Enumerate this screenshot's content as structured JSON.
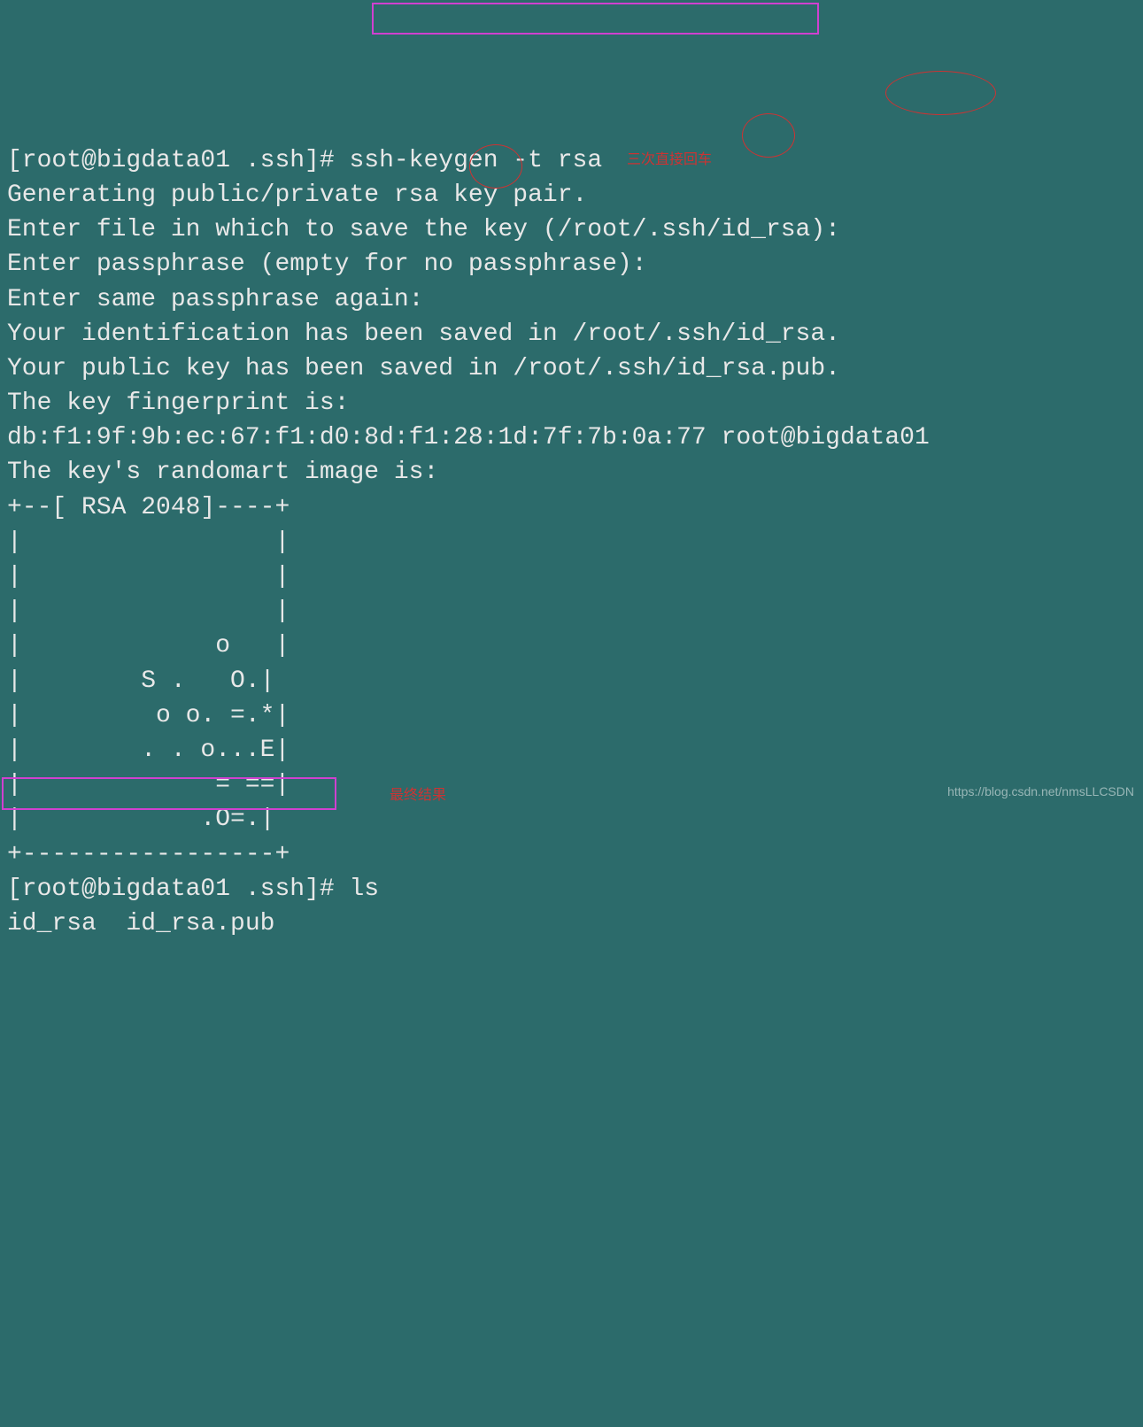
{
  "terminal": {
    "prompt1": "[root@bigdata01 .ssh]# ",
    "command1": "ssh-keygen -t rsa",
    "line1": "Generating public/private rsa key pair.",
    "line2": "Enter file in which to save the key (/root/.ssh/id_rsa):",
    "line3": "Enter passphrase (empty for no passphrase):",
    "line4": "Enter same passphrase again:",
    "line5": "Your identification has been saved in /root/.ssh/id_rsa.",
    "line6": "Your public key has been saved in /root/.ssh/id_rsa.pub.",
    "line7": "The key fingerprint is:",
    "line8": "db:f1:9f:9b:ec:67:f1:d0:8d:f1:28:1d:7f:7b:0a:77 root@bigdata01",
    "line9": "The key's randomart image is:",
    "art1": "+--[ RSA 2048]----+",
    "art2": "|                 |",
    "art3": "|                 |",
    "art4": "|                 |",
    "art5": "|             o   |",
    "art6": "|        S .   O.|",
    "art7": "|         o o. =.*|",
    "art8": "|        . . o...E|",
    "art9": "|             = ==|",
    "art10": "|            .O=.|",
    "art11": "+-----------------+",
    "prompt2": "[root@bigdata01 .ssh]# ",
    "command2": "ls",
    "output2": "id_rsa  id_rsa.pub"
  },
  "annotations": {
    "red_text_1": "三次直接回车",
    "red_text_2": "最终结果",
    "watermark": "https://blog.csdn.net/nmsLLCSDN"
  }
}
